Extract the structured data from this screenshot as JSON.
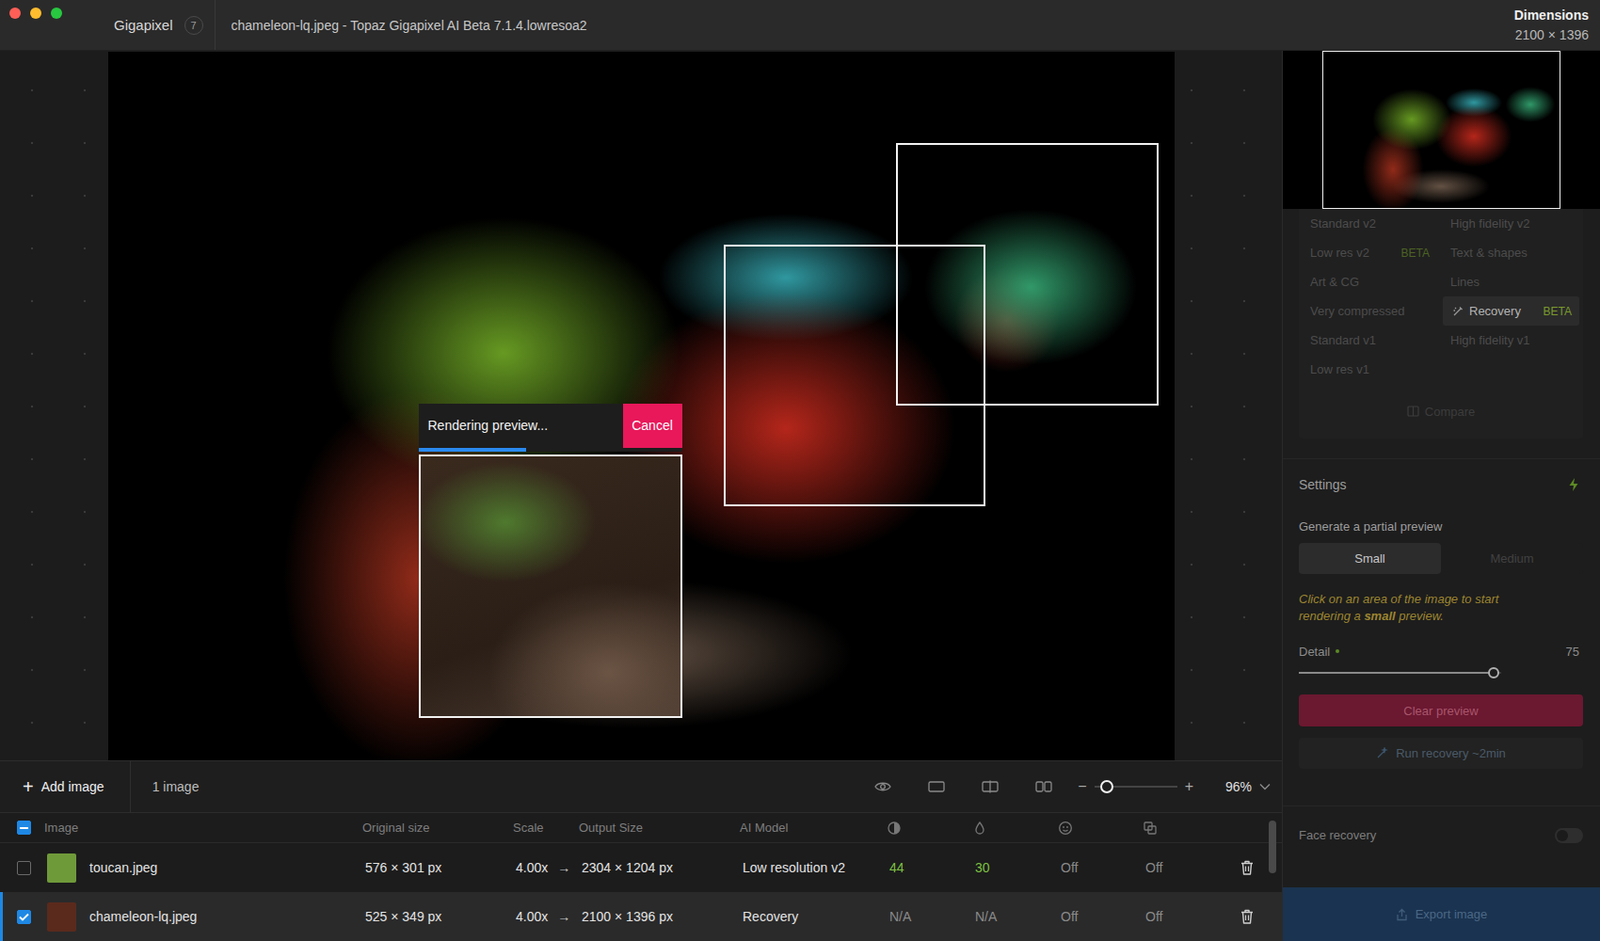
{
  "window": {
    "app": "Gigapixel",
    "badge": "7",
    "title": "chameleon-lq.jpeg - Topaz Gigapixel AI Beta 7.1.4.lowresoa2",
    "dimensions_label": "Dimensions",
    "dimensions": "2100 × 1396"
  },
  "preview": {
    "boxes": [
      {
        "rendering": false
      },
      {
        "rendering": false
      },
      {
        "rendering": true
      }
    ],
    "status": "Rendering preview...",
    "cancel": "Cancel",
    "level": 0.41
  },
  "toolbar": {
    "add_icon": "+",
    "add": "Add image",
    "count": "1 image",
    "zoom_out": "−",
    "zoom_in": "+",
    "zoom_level": 0.14,
    "zoom": "96%"
  },
  "table": {
    "partial": true,
    "columns": [
      "Image",
      "Original size",
      "Scale",
      "Output Size",
      "AI Model"
    ],
    "rows": [
      {
        "name": "toucan.jpeg",
        "checked": false,
        "selected": false,
        "color": "#6f9a3a",
        "original": "576 × 301 px",
        "scale": "4.00x",
        "arrow": "→",
        "output": "2304 × 1204 px",
        "model": "Low resolution v2",
        "values": [
          {
            "text": "44",
            "active": true
          },
          {
            "text": "30",
            "active": true
          },
          {
            "text": "Off",
            "active": false
          },
          {
            "text": "Off",
            "active": false
          }
        ]
      },
      {
        "name": "chameleon-lq.jpeg",
        "checked": true,
        "selected": true,
        "color": "#5a2a1c",
        "original": "525 × 349 px",
        "scale": "4.00x",
        "arrow": "→",
        "output": "2100 × 1396 px",
        "model": "Recovery",
        "values": [
          {
            "text": "N/A",
            "active": false
          },
          {
            "text": "N/A",
            "active": false
          },
          {
            "text": "Off",
            "active": false
          },
          {
            "text": "Off",
            "active": false
          }
        ]
      }
    ]
  },
  "right_panel": {
    "dimmed": true
  },
  "models": [
    {
      "label": "Standard v2",
      "selected": false
    },
    {
      "label": "High fidelity v2",
      "selected": false
    },
    {
      "label": "Low res v2",
      "badge": "BETA",
      "selected": false
    },
    {
      "label": "Text & shapes",
      "selected": false
    },
    {
      "label": "Art & CG",
      "selected": false
    },
    {
      "label": "Lines",
      "selected": false
    },
    {
      "label": "Very compressed",
      "selected": false
    },
    {
      "label": "Recovery",
      "badge": "BETA",
      "selected": true
    },
    {
      "label": "Standard v1",
      "selected": false
    },
    {
      "label": "High fidelity v1",
      "selected": false
    },
    {
      "label": "Low res v1",
      "selected": false
    }
  ],
  "compare": "Compare",
  "settings": {
    "title": "Settings",
    "subtitle": "Generate a partial preview",
    "sizes": [
      {
        "label": "Small",
        "selected": true
      },
      {
        "label": "Medium",
        "selected": false
      }
    ],
    "hint_before": "Click on an area of the image to start rendering a ",
    "hint_strong": "small",
    "hint_after": " preview.",
    "detail": {
      "label": "Detail",
      "value": "75",
      "level": 0.96,
      "modified": true
    },
    "clear": "Clear preview",
    "run": "Run recovery ~2min"
  },
  "face_recovery": {
    "label": "Face recovery",
    "on": false
  },
  "export": "Export image"
}
